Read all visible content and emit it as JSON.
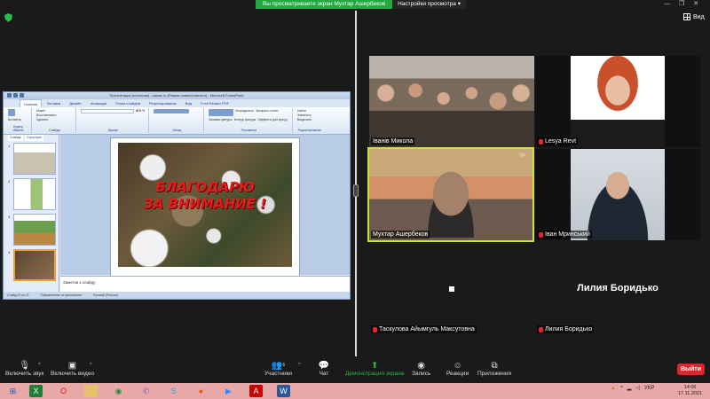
{
  "banner": {
    "message": "Вы просматриваете экран Мухтар Ашербеков",
    "options": "Настройки просмотра ▾"
  },
  "window_controls": [
    "—",
    "❐",
    "✕"
  ],
  "view_label": "Вид",
  "ppt": {
    "title": "Презентация (печатная) - какая-то (Режим совместимости) - Microsoft PowerPoint",
    "tabs": [
      "Главная",
      "Вставка",
      "Дизайн",
      "Анимация",
      "Показ слайдов",
      "Рецензирование",
      "Вид",
      "Foxit Reader PDF"
    ],
    "groups": [
      "Буфер обмена",
      "Слайды",
      "Шрифт",
      "Абзац",
      "Рисование",
      "Редактирование"
    ],
    "ribbon_items": [
      "Вставить",
      "Макет",
      "Восстановить",
      "Удалить",
      "Упорядочить",
      "Экспресс-стили",
      "Заливка фигуры",
      "Контур фигуры",
      "Эффекты для фигур",
      "Найти",
      "Заменить",
      "Выделить"
    ],
    "thumb_tabs": [
      "Слайды",
      "Структура"
    ],
    "thumb_numbers": [
      "1",
      "2",
      "3",
      "4"
    ],
    "slide_text_line1": "БЛАГОДАРЮ",
    "slide_text_line2": "ЗА ВНИМАНИЕ !",
    "notes": "Заметки к слайду",
    "status": [
      "Слайд 21 из 21",
      "\"Оформление по умолчанию\"",
      "Русский (Россия)"
    ]
  },
  "participants": [
    {
      "name": "Іванів Микола",
      "muted": false
    },
    {
      "name": "Lesya Revt",
      "muted": true
    },
    {
      "name": "Мухтар Ашербеков",
      "muted": false
    },
    {
      "name": "Іван Мринський",
      "muted": true
    },
    {
      "name": "Таскулова Айымгуль Максутовна",
      "muted": true
    },
    {
      "name": "Лилия Боридько",
      "muted": true
    }
  ],
  "t6_big_name": "Лилия Боридько",
  "t3_brand": "Qp",
  "toolbar": {
    "unmute": "Включить звук",
    "start_video": "Включить видео",
    "participants": "Участники",
    "participants_count": "6",
    "chat": "Чат",
    "share": "Демонстрация экрана",
    "record": "Запись",
    "reactions": "Реакции",
    "apps": "Приложения",
    "leave": "Выйти"
  },
  "taskbar": {
    "lang": "УКР",
    "time": "14:06",
    "date": "17.11.2021"
  },
  "colors": {
    "share_green": "#23a942",
    "leave_red": "#e0242d",
    "active_speaker": "#cfe03b",
    "taskbar": "#e8a8a8"
  }
}
